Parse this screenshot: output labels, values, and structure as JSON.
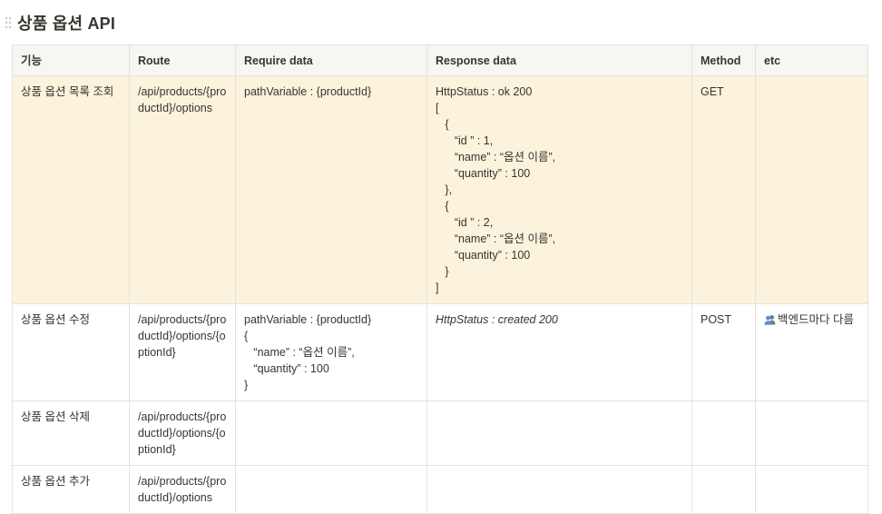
{
  "page": {
    "title": "상품 옵션 API"
  },
  "table": {
    "headers": {
      "feature": "기능",
      "route": "Route",
      "require": "Require data",
      "response": "Response data",
      "method": "Method",
      "etc": "etc"
    },
    "rows": [
      {
        "feature": "상품 옵션 목록 조회",
        "route": "/api/products/{productId}/options",
        "require": "pathVariable : {productId}",
        "response": "HttpStatus : ok 200\n[\n   {\n      “id ” : 1,\n      “name” : “옵션 이름”,\n      “quantity” : 100\n   },\n   {\n      “id ” : 2,\n      “name” : “옵션 이름”,\n      “quantity” : 100\n   }\n]",
        "method": "GET",
        "etc": ""
      },
      {
        "feature": "상품 옵션 수정",
        "route": "/api/products/{productId}/options/{optionId}",
        "require": "pathVariable : {productId}\n{\n   “name” : “옵션 이름”,\n   “quantity” : 100\n}",
        "response": "HttpStatus : created 200",
        "method": "POST",
        "etc": "백엔드마다 다름",
        "etc_icon": "people-icon"
      },
      {
        "feature": "상품 옵션 삭제",
        "route": "/api/products/{productId}/options/{optionId}",
        "require": "",
        "response": "",
        "method": "",
        "etc": ""
      },
      {
        "feature": "상품 옵션 추가",
        "route": "/api/products/{productId}/options",
        "require": "",
        "response": "",
        "method": "",
        "etc": ""
      }
    ]
  },
  "colors": {
    "highlight_row": "#fbf3db",
    "header_bg": "#f7f6f3",
    "border": "#e3e2df",
    "text": "#37352f"
  }
}
